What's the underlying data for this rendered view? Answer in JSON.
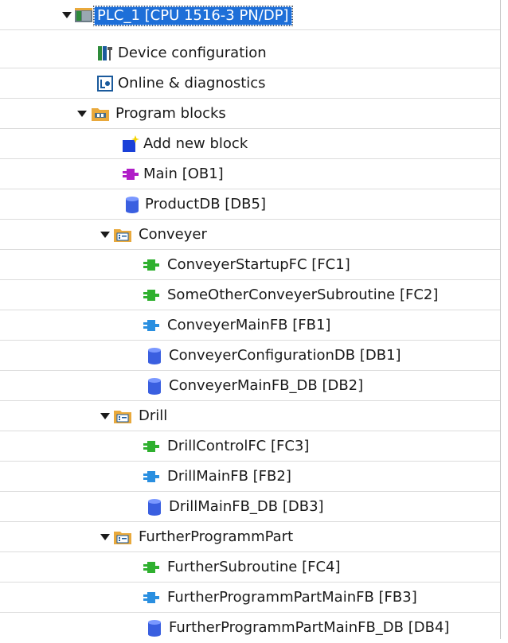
{
  "tree": {
    "items": [
      {
        "label": "PLC_1 [CPU 1516-3 PN/DP]",
        "icon": "plc-cpu-icon",
        "selected": true,
        "expanded": true
      },
      {
        "label": "Device configuration",
        "icon": "device-configuration-icon"
      },
      {
        "label": "Online & diagnostics",
        "icon": "online-diagnostics-icon"
      },
      {
        "label": "Program blocks",
        "icon": "program-blocks-folder-icon",
        "expanded": true
      },
      {
        "label": "Add new block",
        "icon": "add-new-block-icon"
      },
      {
        "label": "Main [OB1]",
        "icon": "organization-block-icon"
      },
      {
        "label": "ProductDB [DB5]",
        "icon": "data-block-icon"
      },
      {
        "label": "Conveyer",
        "icon": "group-folder-icon",
        "expanded": true
      },
      {
        "label": "ConveyerStartupFC [FC1]",
        "icon": "function-icon"
      },
      {
        "label": "SomeOtherConveyerSubroutine [FC2]",
        "icon": "function-icon"
      },
      {
        "label": "ConveyerMainFB [FB1]",
        "icon": "function-block-icon"
      },
      {
        "label": "ConveyerConfigurationDB [DB1]",
        "icon": "data-block-icon"
      },
      {
        "label": "ConveyerMainFB_DB [DB2]",
        "icon": "data-block-icon"
      },
      {
        "label": "Drill",
        "icon": "group-folder-icon",
        "expanded": true
      },
      {
        "label": "DrillControlFC [FC3]",
        "icon": "function-icon"
      },
      {
        "label": "DrillMainFB [FB2]",
        "icon": "function-block-icon"
      },
      {
        "label": "DrillMainFB_DB [DB3]",
        "icon": "data-block-icon"
      },
      {
        "label": "FurtherProgrammPart",
        "icon": "group-folder-icon",
        "expanded": true
      },
      {
        "label": "FurtherSubroutine [FC4]",
        "icon": "function-icon"
      },
      {
        "label": "FurtherProgrammPartMainFB [FB3]",
        "icon": "function-block-icon"
      },
      {
        "label": "FurtherProgrammPartMainFB_DB [DB4]",
        "icon": "data-block-icon"
      }
    ]
  },
  "colors": {
    "selection": "#1e6fd8",
    "function_green": "#2fb02f",
    "function_block_blue": "#2a8fe0",
    "organization_block_purple": "#b01ec8",
    "data_block_blue": "#3a5fe0",
    "folder_orange": "#e9a93c"
  }
}
